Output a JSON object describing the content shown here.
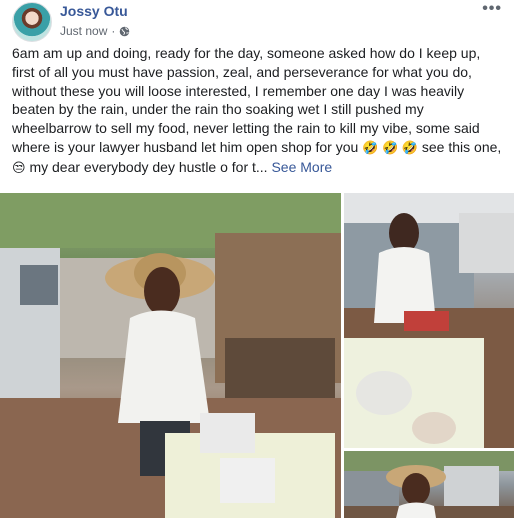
{
  "post": {
    "author": "Jossy Otu",
    "timestamp": "Just now",
    "separator": "·",
    "privacy_icon": "globe-icon",
    "more_icon": "more-icon",
    "more_glyph": "•••",
    "text": "6am am up and doing, ready for the day, someone asked how do I keep up, first of all you must have passion, zeal, and perseverance for what you do, without these you will loose interested, I remember one day I was heavily beaten by the rain, under the rain tho soaking wet I still pushed my wheelbarrow to sell my food, never letting the rain to kill my vibe, some said where is your lawyer husband let him open shop for you",
    "emoji_laugh": "🤣 🤣 🤣",
    "text_2": " see this one,",
    "emoji_unamused": "😒",
    "text_3": " my dear everybody dey hustle o for t...",
    "see_more": "See More"
  },
  "colors": {
    "link": "#385898",
    "meta": "#606770",
    "text": "#1c1e21"
  }
}
